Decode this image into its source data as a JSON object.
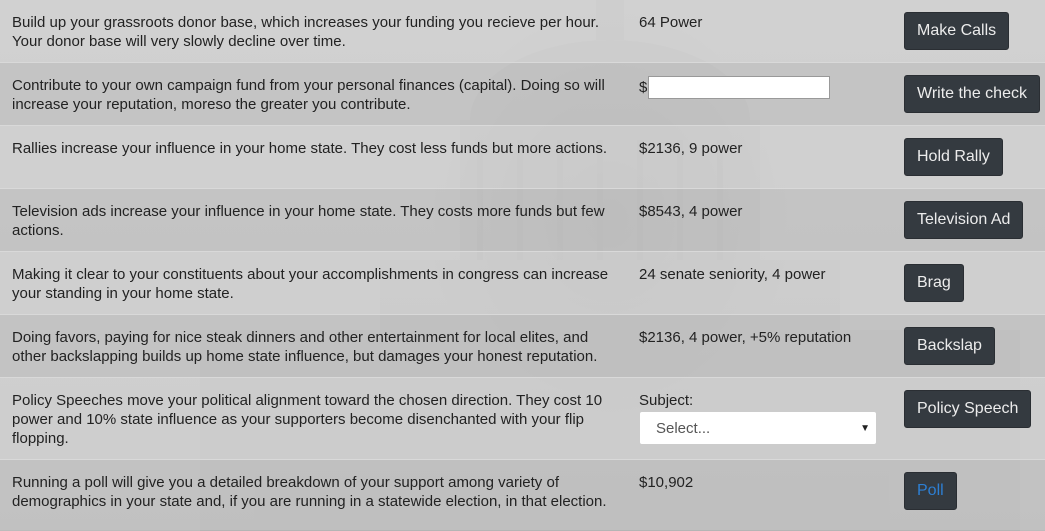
{
  "rows": [
    {
      "description": "Build up your grassroots donor base, which increases your funding you recieve per hour. Your donor base will very slowly decline over time.",
      "cost": "64 Power",
      "button": "Make Calls"
    },
    {
      "description": "Contribute to your own campaign fund from your personal finances (capital). Doing so will increase your reputation, moreso the greater you contribute.",
      "currency_symbol": "$",
      "amount_value": "",
      "button": "Write the check"
    },
    {
      "description": "Rallies increase your influence in your home state. They cost less funds but more actions.",
      "cost": "$2136, 9 power",
      "button": "Hold Rally"
    },
    {
      "description": "Television ads increase your influence in your home state. They costs more funds but few actions.",
      "cost": "$8543, 4 power",
      "button": "Television Ad"
    },
    {
      "description": "Making it clear to your constituents about your accomplishments in congress can increase your standing in your home state.",
      "cost": "24 senate seniority, 4 power",
      "button": "Brag"
    },
    {
      "description": "Doing favors, paying for nice steak dinners and other entertainment for local elites, and other backslapping builds up home state influence, but damages your honest reputation.",
      "cost": "$2136, 4 power, +5% reputation",
      "button": "Backslap"
    },
    {
      "description": "Policy Speeches move your political alignment toward the chosen direction. They cost 10 power and 10% state influence as your supporters become disenchanted with your flip flopping.",
      "subject_label": "Subject:",
      "subject_selected": "Select...",
      "button": "Policy Speech"
    },
    {
      "description": "Running a poll will give you a detailed breakdown of your support among variety of demographics in your state and, if you are running in a statewide election, in that election.",
      "cost": "$10,902",
      "button": "Poll"
    }
  ],
  "icons": {
    "select_caret": "chevron-down-icon"
  },
  "colors": {
    "button_bg": "#343a40",
    "button_text": "#ececec",
    "poll_link_text": "#2d7fd3"
  }
}
